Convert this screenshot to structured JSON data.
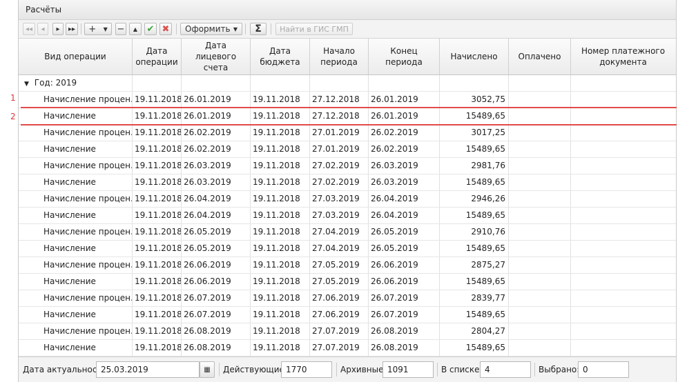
{
  "panel": {
    "title": "Расчёты"
  },
  "toolbar": {
    "oformit_label": "Оформить",
    "gis_label": "Найти в ГИС ГМП",
    "sum_label": "Σ"
  },
  "columns": [
    "Вид операции",
    "Дата операции",
    "Дата лицевого счета",
    "Дата бюджета",
    "Начало периода",
    "Конец периода",
    "Начислено",
    "Оплачено",
    "Номер платежного документа"
  ],
  "group_label": "Год: 2019",
  "rows": [
    {
      "op": "Начисление процен...",
      "d1": "19.11.2018",
      "d2": "26.01.2019",
      "d3": "19.11.2018",
      "d4": "27.12.2018",
      "d5": "26.01.2019",
      "sum": "3052,75"
    },
    {
      "op": "Начисление",
      "d1": "19.11.2018",
      "d2": "26.01.2019",
      "d3": "19.11.2018",
      "d4": "27.12.2018",
      "d5": "26.01.2019",
      "sum": "15489,65"
    },
    {
      "op": "Начисление процен...",
      "d1": "19.11.2018",
      "d2": "26.02.2019",
      "d3": "19.11.2018",
      "d4": "27.01.2019",
      "d5": "26.02.2019",
      "sum": "3017,25"
    },
    {
      "op": "Начисление",
      "d1": "19.11.2018",
      "d2": "26.02.2019",
      "d3": "19.11.2018",
      "d4": "27.01.2019",
      "d5": "26.02.2019",
      "sum": "15489,65"
    },
    {
      "op": "Начисление процен...",
      "d1": "19.11.2018",
      "d2": "26.03.2019",
      "d3": "19.11.2018",
      "d4": "27.02.2019",
      "d5": "26.03.2019",
      "sum": "2981,76"
    },
    {
      "op": "Начисление",
      "d1": "19.11.2018",
      "d2": "26.03.2019",
      "d3": "19.11.2018",
      "d4": "27.02.2019",
      "d5": "26.03.2019",
      "sum": "15489,65"
    },
    {
      "op": "Начисление процен...",
      "d1": "19.11.2018",
      "d2": "26.04.2019",
      "d3": "19.11.2018",
      "d4": "27.03.2019",
      "d5": "26.04.2019",
      "sum": "2946,26"
    },
    {
      "op": "Начисление",
      "d1": "19.11.2018",
      "d2": "26.04.2019",
      "d3": "19.11.2018",
      "d4": "27.03.2019",
      "d5": "26.04.2019",
      "sum": "15489,65"
    },
    {
      "op": "Начисление процен...",
      "d1": "19.11.2018",
      "d2": "26.05.2019",
      "d3": "19.11.2018",
      "d4": "27.04.2019",
      "d5": "26.05.2019",
      "sum": "2910,76"
    },
    {
      "op": "Начисление",
      "d1": "19.11.2018",
      "d2": "26.05.2019",
      "d3": "19.11.2018",
      "d4": "27.04.2019",
      "d5": "26.05.2019",
      "sum": "15489,65"
    },
    {
      "op": "Начисление процен...",
      "d1": "19.11.2018",
      "d2": "26.06.2019",
      "d3": "19.11.2018",
      "d4": "27.05.2019",
      "d5": "26.06.2019",
      "sum": "2875,27"
    },
    {
      "op": "Начисление",
      "d1": "19.11.2018",
      "d2": "26.06.2019",
      "d3": "19.11.2018",
      "d4": "27.05.2019",
      "d5": "26.06.2019",
      "sum": "15489,65"
    },
    {
      "op": "Начисление процен...",
      "d1": "19.11.2018",
      "d2": "26.07.2019",
      "d3": "19.11.2018",
      "d4": "27.06.2019",
      "d5": "26.07.2019",
      "sum": "2839,77"
    },
    {
      "op": "Начисление",
      "d1": "19.11.2018",
      "d2": "26.07.2019",
      "d3": "19.11.2018",
      "d4": "27.06.2019",
      "d5": "26.07.2019",
      "sum": "15489,65"
    },
    {
      "op": "Начисление процен...",
      "d1": "19.11.2018",
      "d2": "26.08.2019",
      "d3": "19.11.2018",
      "d4": "27.07.2019",
      "d5": "26.08.2019",
      "sum": "2804,27"
    },
    {
      "op": "Начисление",
      "d1": "19.11.2018",
      "d2": "26.08.2019",
      "d3": "19.11.2018",
      "d4": "27.07.2019",
      "d5": "26.08.2019",
      "sum": "15489,65"
    }
  ],
  "markers": [
    "1",
    "2"
  ],
  "status": {
    "date_label": "Дата актуальности",
    "date_value": "25.03.2019",
    "active_label": "Действующие:",
    "active_value": "1770",
    "archive_label": "Архивные:",
    "archive_value": "1091",
    "list_label": "В списке:",
    "list_value": "4",
    "selected_label": "Выбрано:",
    "selected_value": "0"
  },
  "colors": {
    "accent_red": "#e24a4a",
    "check_green": "#3aa33a",
    "cross_red": "#d9534f"
  }
}
